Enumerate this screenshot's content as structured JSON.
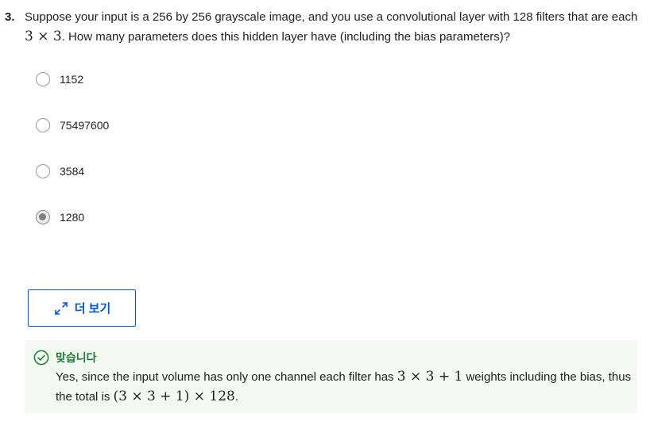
{
  "question": {
    "number": "3.",
    "text_part1": "Suppose your input is a 256 by 256 grayscale image, and you use a convolutional layer with 128 filters that are each",
    "math_size": "3 × 3",
    "text_part2": ". How many parameters does this hidden layer have (including the bias parameters)?"
  },
  "options": [
    {
      "label": "1152",
      "selected": false
    },
    {
      "label": "75497600",
      "selected": false
    },
    {
      "label": "3584",
      "selected": false
    },
    {
      "label": "1280",
      "selected": true
    }
  ],
  "more_button": {
    "label": "더 보기",
    "icon": "expand-arrows-icon"
  },
  "feedback": {
    "status": "맞습니다",
    "icon": "check-circle-icon",
    "text_part1": "Yes, since the input volume has only one channel each filter has ",
    "math_weights": "3 × 3 + 1",
    "text_part2": " weights including the bias, thus the total is ",
    "math_total": "(3 × 3 + 1) × 128",
    "text_part3": "."
  },
  "colors": {
    "accent": "#0056d2",
    "success": "#1e7b34",
    "feedback_bg": "#f3f8f3"
  }
}
